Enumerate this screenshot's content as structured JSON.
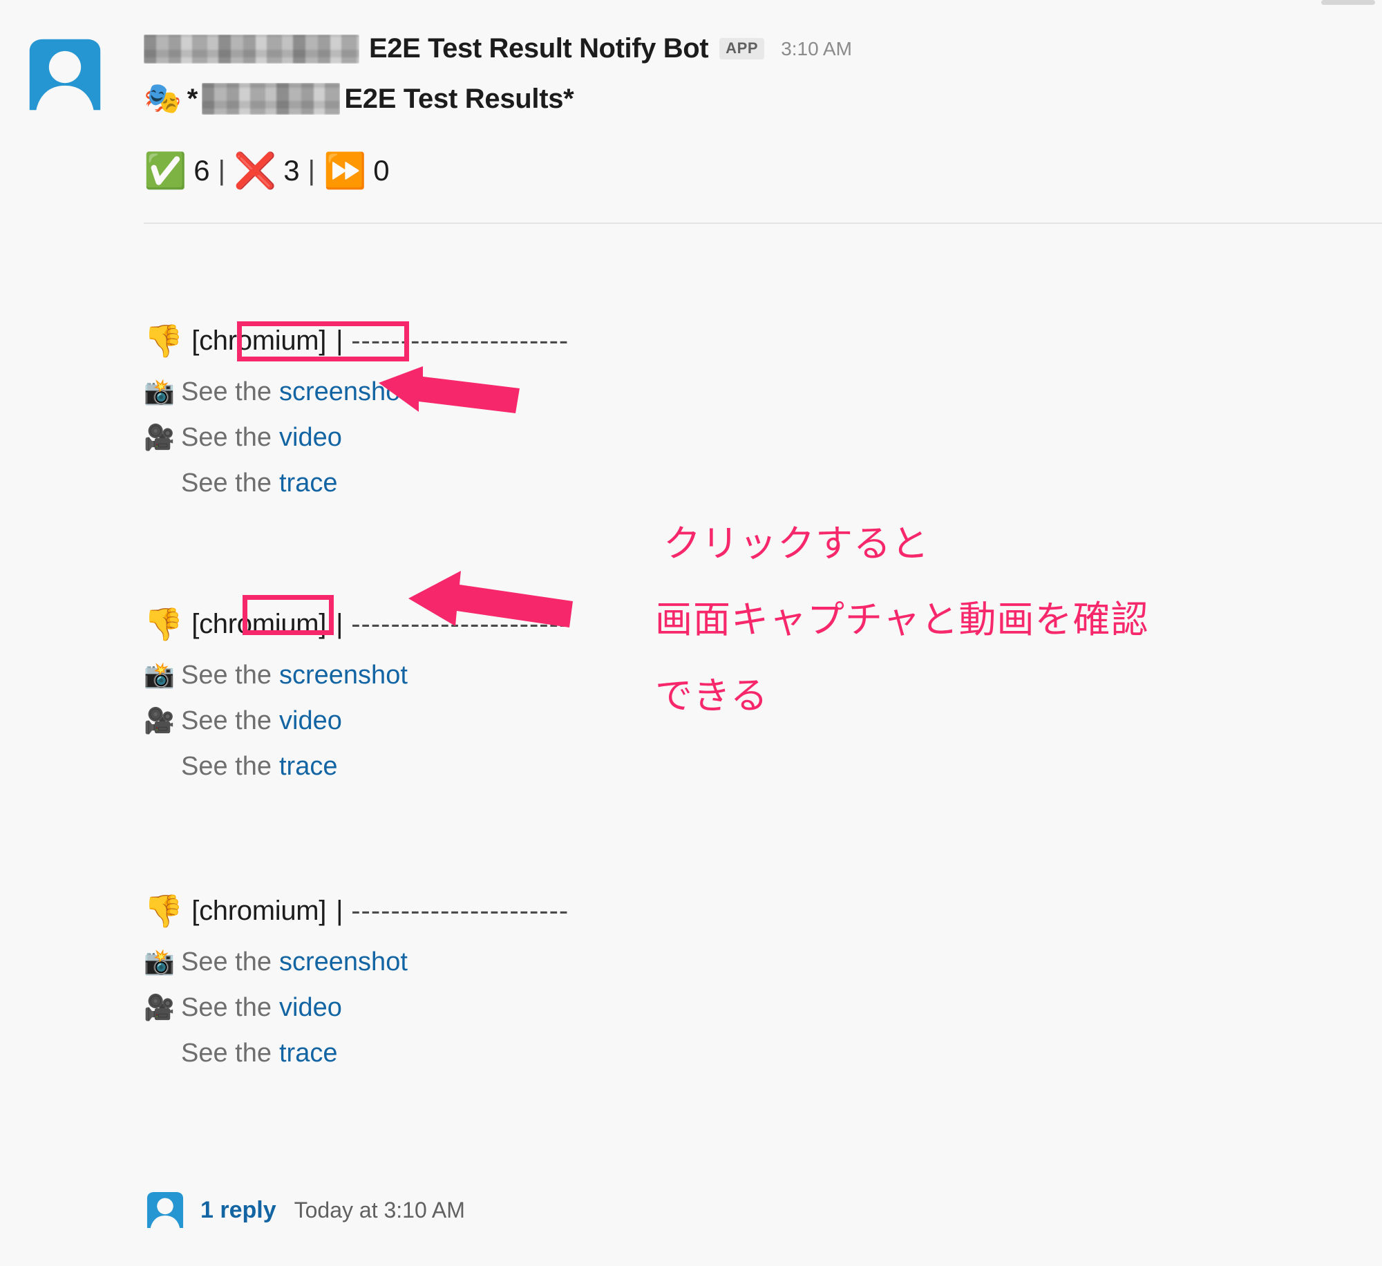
{
  "window": {
    "background_color": "#f8f8f8",
    "link_color": "#1264a3",
    "annotation_color": "#f7276b",
    "avatar_color": "#2596d1"
  },
  "message": {
    "avatar_icon": "person-avatar-icon",
    "sender_name_redacted": true,
    "sender_name": "E2E Test Result Notify Bot",
    "app_badge": "APP",
    "timestamp": "3:10 AM",
    "title": {
      "emoji": "🎭",
      "emoji_name": "performing-arts-icon",
      "prefix": "*",
      "redacted": true,
      "text": "E2E Test Results*"
    },
    "stats": [
      {
        "emoji": "✅",
        "emoji_name": "check-mark-button-icon",
        "label": "passed",
        "value": "6"
      },
      {
        "emoji": "❌",
        "emoji_name": "cross-mark-icon",
        "label": "failed",
        "value": "3"
      },
      {
        "emoji": "⏩",
        "emoji_name": "fast-forward-icon",
        "label": "skipped",
        "value": "0"
      }
    ],
    "stat_separator": "|"
  },
  "results": [
    {
      "status_emoji": "👎",
      "status_emoji_name": "thumbs-down-icon",
      "browser": "[chromium]",
      "pipe": "|",
      "test_name_redacted": "----------------------",
      "links": [
        {
          "icon": "📸",
          "icon_name": "camera-with-flash-icon",
          "prefix": "See the",
          "label": "screenshot"
        },
        {
          "icon": "🎥",
          "icon_name": "movie-camera-icon",
          "prefix": "See the",
          "label": "video"
        },
        {
          "icon": "",
          "icon_name": "no-icon",
          "prefix": "See the",
          "label": "trace"
        }
      ]
    },
    {
      "status_emoji": "👎",
      "status_emoji_name": "thumbs-down-icon",
      "browser": "[chromium]",
      "pipe": "|",
      "test_name_redacted": "----------------------",
      "links": [
        {
          "icon": "📸",
          "icon_name": "camera-with-flash-icon",
          "prefix": "See the",
          "label": "screenshot"
        },
        {
          "icon": "🎥",
          "icon_name": "movie-camera-icon",
          "prefix": "See the",
          "label": "video"
        },
        {
          "icon": "",
          "icon_name": "no-icon",
          "prefix": "See the",
          "label": "trace"
        }
      ]
    },
    {
      "status_emoji": "👎",
      "status_emoji_name": "thumbs-down-icon",
      "browser": "[chromium]",
      "pipe": "|",
      "test_name_redacted": "----------------------",
      "links": [
        {
          "icon": "📸",
          "icon_name": "camera-with-flash-icon",
          "prefix": "See the",
          "label": "screenshot"
        },
        {
          "icon": "🎥",
          "icon_name": "movie-camera-icon",
          "prefix": "See the",
          "label": "video"
        },
        {
          "icon": "",
          "icon_name": "no-icon",
          "prefix": "See the",
          "label": "trace"
        }
      ]
    }
  ],
  "thread": {
    "avatar_icon": "person-avatar-icon",
    "reply_count_label": "1 reply",
    "reply_timestamp": "Today at 3:10 AM"
  },
  "annotation": {
    "line1": "クリックすると",
    "line2": "画面キャプチャと動画を確認",
    "line3": "できる",
    "highlight_1_target": "screenshot",
    "highlight_2_target": "video"
  }
}
